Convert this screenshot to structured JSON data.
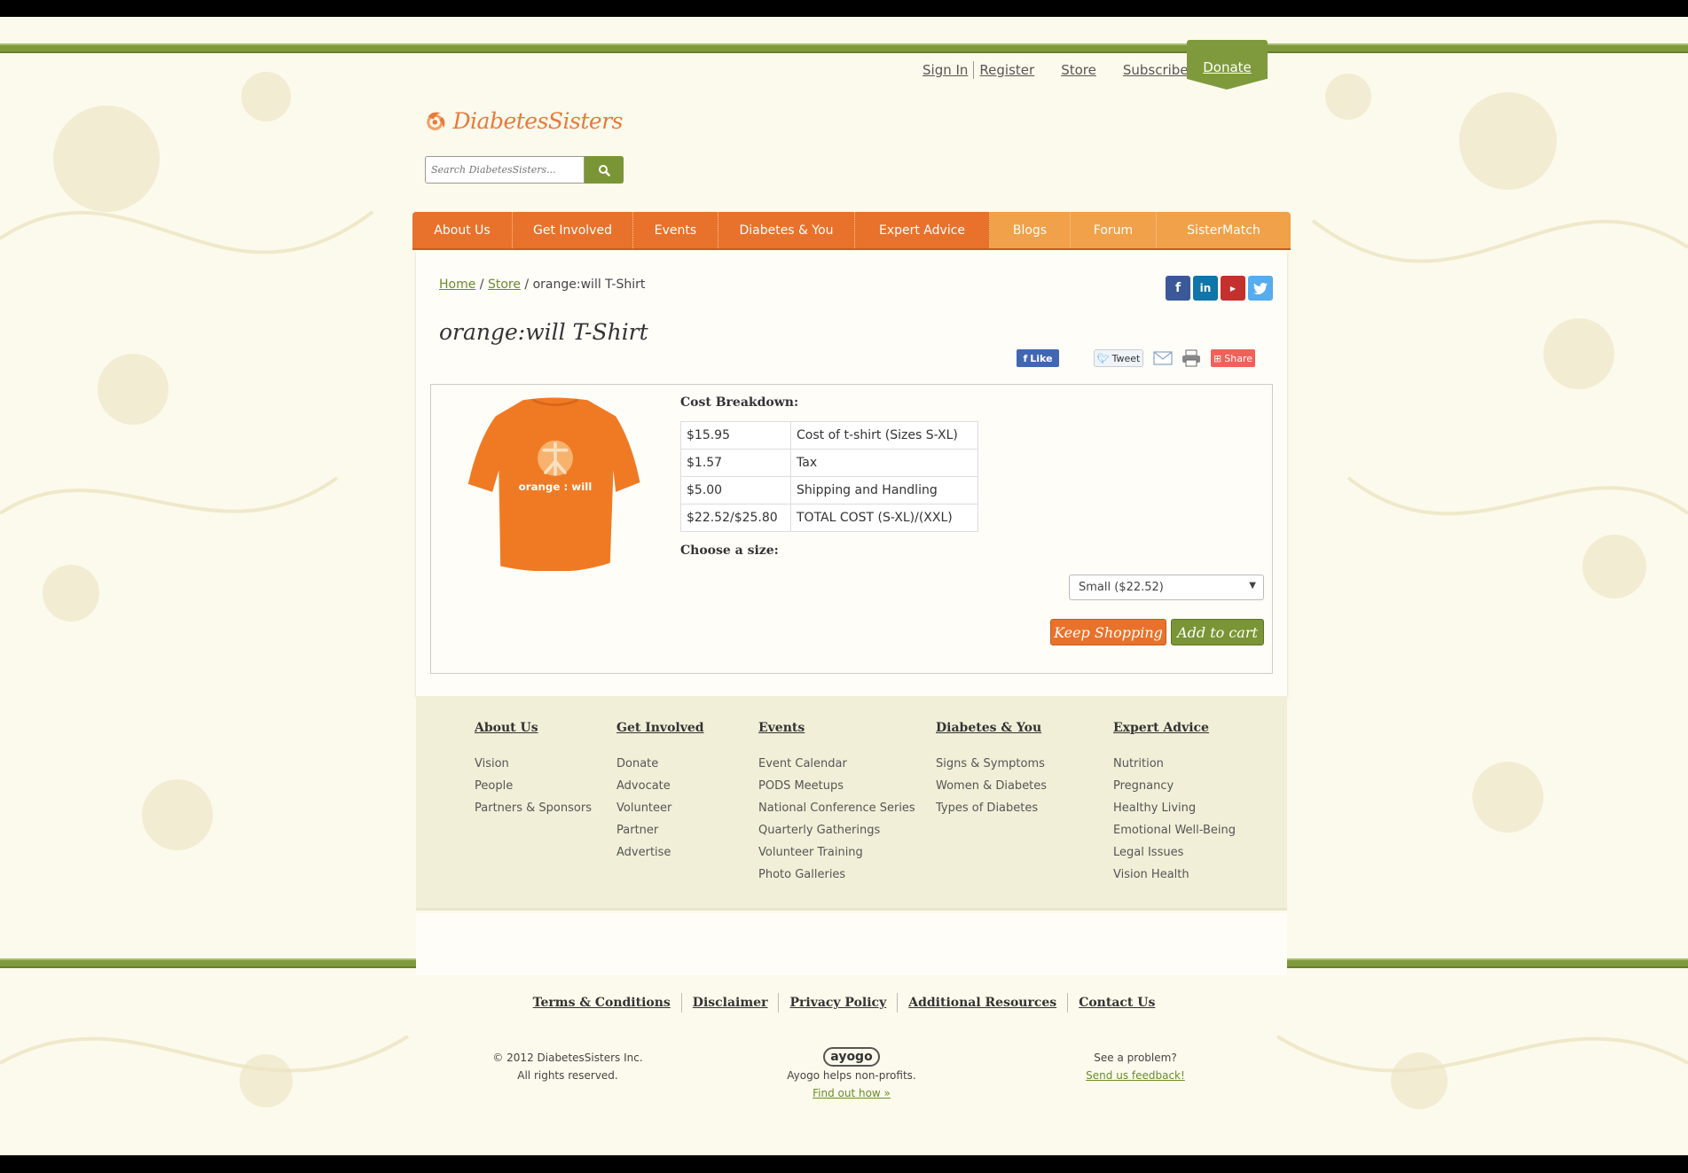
{
  "top_links": {
    "sign_in": "Sign In",
    "register": "Register",
    "store": "Store",
    "subscribe": "Subscribe",
    "donate": "Donate"
  },
  "logo": {
    "text": "DiabetesSisters"
  },
  "search": {
    "placeholder": "Search DiabetesSisters..."
  },
  "nav": {
    "items": [
      "About Us",
      "Get Involved",
      "Events",
      "Diabetes & You",
      "Expert Advice",
      "Blogs",
      "Forum",
      "SisterMatch"
    ]
  },
  "breadcrumb": {
    "home": "Home",
    "store": "Store",
    "current": "orange:will T-Shirt"
  },
  "social_icons": [
    "facebook-icon",
    "linkedin-icon",
    "youtube-icon",
    "twitter-icon"
  ],
  "product": {
    "title": "orange:will T-Shirt",
    "shirt_text": "orange : will",
    "share": {
      "like": "Like",
      "tweet": "Tweet",
      "share": "Share"
    },
    "cost_heading": "Cost Breakdown:",
    "cost_rows": [
      {
        "amount": "$15.95",
        "label": "Cost of t-shirt (Sizes S-XL)"
      },
      {
        "amount": "$1.57",
        "label": "Tax"
      },
      {
        "amount": "$5.00",
        "label": "Shipping and Handling"
      },
      {
        "amount": "$22.52/$25.80",
        "label": "TOTAL COST (S-XL)/(XXL)"
      }
    ],
    "size_heading": "Choose a size:",
    "size_selected": "Small ($22.52)",
    "keep_shopping": "Keep Shopping",
    "add_to_cart": "Add to cart"
  },
  "footer_columns": [
    {
      "heading": "About Us",
      "links": [
        "Vision",
        "People",
        "Partners & Sponsors"
      ]
    },
    {
      "heading": "Get Involved",
      "links": [
        "Donate",
        "Advocate",
        "Volunteer",
        "Partner",
        "Advertise"
      ]
    },
    {
      "heading": "Events",
      "links": [
        "Event Calendar",
        "PODS Meetups",
        "National Conference Series",
        "Quarterly Gatherings",
        "Volunteer Training",
        "Photo Galleries"
      ]
    },
    {
      "heading": "Diabetes & You",
      "links": [
        "Signs & Symptoms",
        "Women & Diabetes",
        "Types of Diabetes"
      ]
    },
    {
      "heading": "Expert Advice",
      "links": [
        "Nutrition",
        "Pregnancy",
        "Healthy Living",
        "Emotional Well-Being",
        "Legal Issues",
        "Vision Health"
      ]
    }
  ],
  "bottom_links": [
    "Terms & Conditions",
    "Disclaimer",
    "Privacy Policy",
    "Additional Resources",
    "Contact Us"
  ],
  "copyright": {
    "line1": "© 2012 DiabetesSisters Inc.",
    "line2": "All rights reserved."
  },
  "ayogo": {
    "logo": "ayogo",
    "text": "Ayogo helps non-profits.",
    "link": "Find out how »"
  },
  "feedback": {
    "text": "See a problem?",
    "link": "Send us feedback!"
  },
  "colors": {
    "orange": "#e8722b",
    "light_orange": "#f0a14a",
    "green": "#7f9a3c",
    "background": "#fcfaec"
  }
}
